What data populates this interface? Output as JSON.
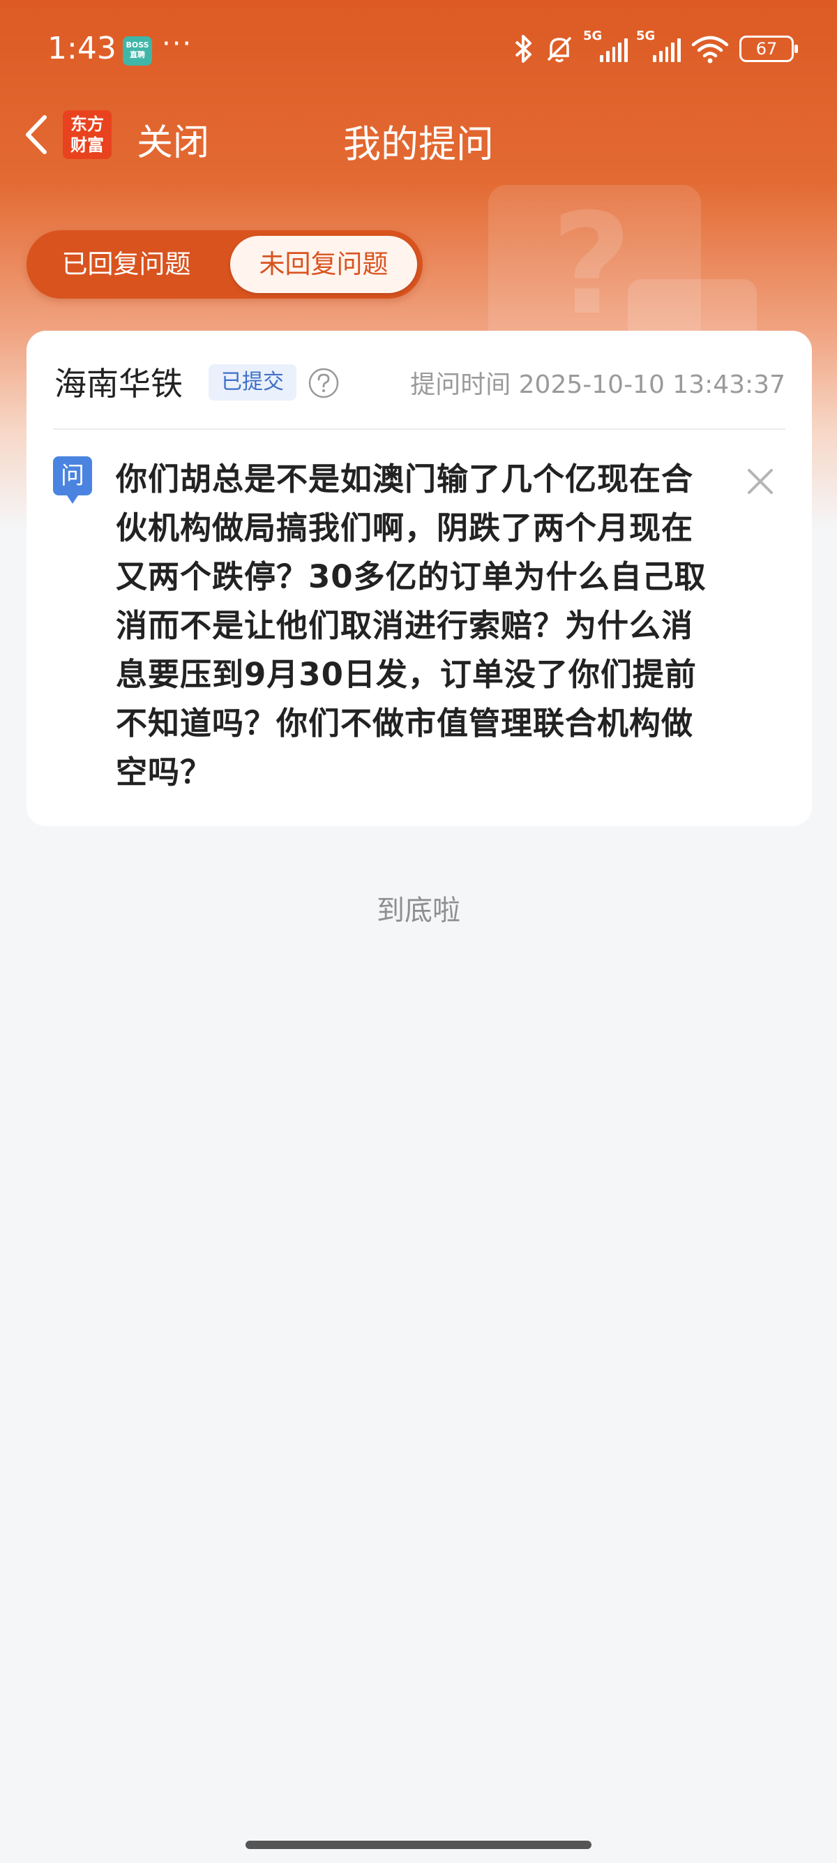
{
  "status_bar": {
    "time": "1:43",
    "app_icon_text": "BOSS直聘",
    "more": "···",
    "signal_1_label": "5G",
    "signal_2_label": "5G",
    "battery": "67"
  },
  "nav": {
    "logo_text": "东方财富",
    "close_label": "关闭",
    "title": "我的提问"
  },
  "tabs": [
    {
      "label": "已回复问题",
      "active": false
    },
    {
      "label": "未回复问题",
      "active": true
    }
  ],
  "question_card": {
    "company": "海南华铁",
    "status_badge": "已提交",
    "ask_time": "提问时间 2025-10-10 13:43:37",
    "q_icon_label": "问",
    "question": "你们胡总是不是如澳门输了几个亿现在合伙机构做局搞我们啊，阴跌了两个月现在又两个跌停？30多亿的订单为什么自己取消而不是让他们取消进行索赔？为什么消息要压到9月30日发，订单没了你们提前不知道吗？你们不做市值管理联合机构做空吗？"
  },
  "footer": {
    "end_text": "到底啦"
  },
  "colors": {
    "brand_orange": "#dd5a24",
    "tab_active_text": "#d9531f",
    "badge_blue": "#3f6fc7",
    "q_icon_blue": "#4a84e0"
  }
}
